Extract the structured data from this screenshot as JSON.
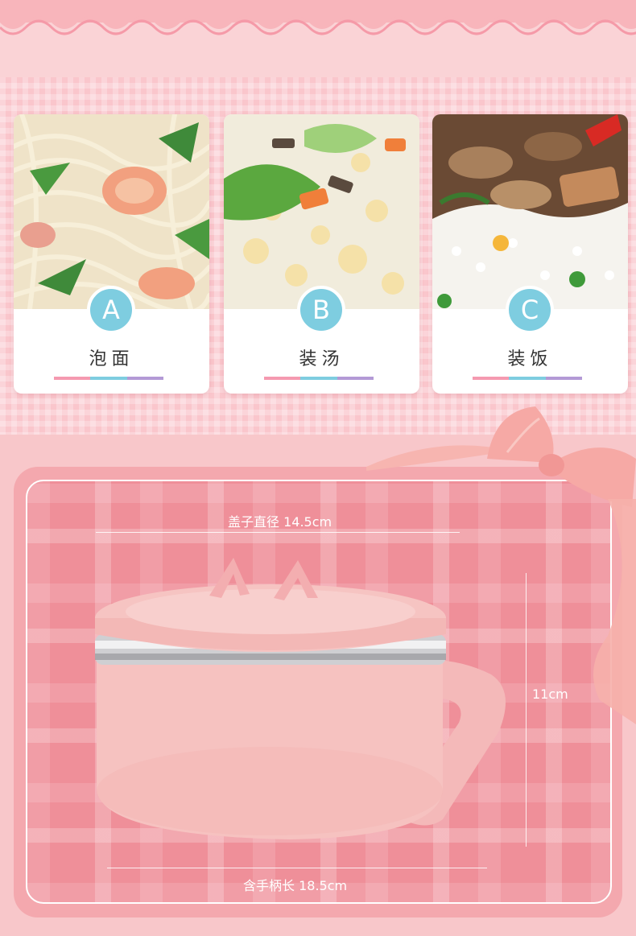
{
  "cards": [
    {
      "letter": "A",
      "label": "泡面"
    },
    {
      "letter": "B",
      "label": "装汤"
    },
    {
      "letter": "C",
      "label": "装饭"
    }
  ],
  "dimensions": {
    "lid_diameter": "盖子直径 14.5cm",
    "height": "11cm",
    "length_with_handle": "含手柄长 18.5cm"
  },
  "colors": {
    "badge": "#7ecde0",
    "tricolor": [
      "#f59ab0",
      "#7ecde0",
      "#b39ad6"
    ],
    "bowl": "#f6c0bf",
    "frame": "#ef8f99"
  }
}
